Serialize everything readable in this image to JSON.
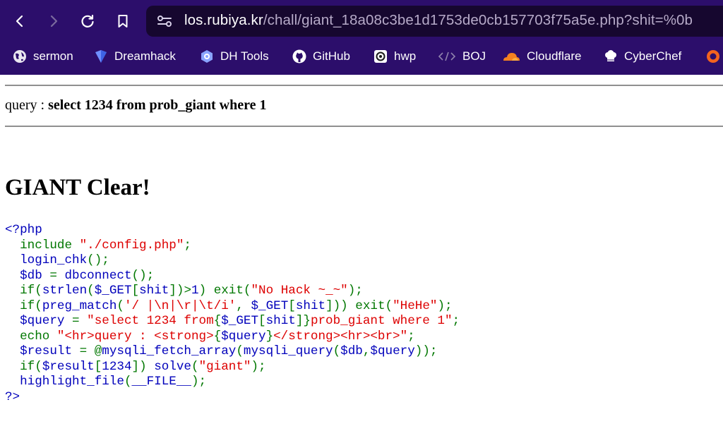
{
  "browser": {
    "url_host": "los.rubiya.kr",
    "url_rest": "/chall/giant_18a08c3be1d1753de0cb157703f75a5e.php?shit=%0b"
  },
  "bookmarks": [
    {
      "label": "sermon",
      "icon": "globe-icon"
    },
    {
      "label": "Dreamhack",
      "icon": "dreamhack-icon"
    },
    {
      "label": "DH Tools",
      "icon": "dh-tools-icon"
    },
    {
      "label": "GitHub",
      "icon": "github-icon"
    },
    {
      "label": "hwp",
      "icon": "hwp-icon"
    },
    {
      "label": "BOJ",
      "icon": "code-brackets-icon"
    },
    {
      "label": "Cloudflare",
      "icon": "cloudflare-icon"
    },
    {
      "label": "CyberChef",
      "icon": "chef-hat-icon"
    }
  ],
  "page": {
    "query_label": "query : ",
    "query_value": "select 1234 from prob_giant where 1",
    "heading": "GIANT Clear!"
  },
  "code": {
    "lines": [
      [
        {
          "t": "<?php",
          "c": "b"
        }
      ],
      [
        {
          "t": "  ",
          "c": "b"
        },
        {
          "t": "include ",
          "c": "k"
        },
        {
          "t": "\"./config.php\"",
          "c": "s"
        },
        {
          "t": ";",
          "c": "k"
        }
      ],
      [
        {
          "t": "  login_chk",
          "c": "b"
        },
        {
          "t": "();",
          "c": "k"
        }
      ],
      [
        {
          "t": "  $db ",
          "c": "b"
        },
        {
          "t": "= ",
          "c": "k"
        },
        {
          "t": "dbconnect",
          "c": "b"
        },
        {
          "t": "();",
          "c": "k"
        }
      ],
      [
        {
          "t": "  ",
          "c": "b"
        },
        {
          "t": "if(",
          "c": "k"
        },
        {
          "t": "strlen",
          "c": "b"
        },
        {
          "t": "(",
          "c": "k"
        },
        {
          "t": "$_GET",
          "c": "b"
        },
        {
          "t": "[",
          "c": "k"
        },
        {
          "t": "shit",
          "c": "b"
        },
        {
          "t": "])>",
          "c": "k"
        },
        {
          "t": "1",
          "c": "b"
        },
        {
          "t": ") exit(",
          "c": "k"
        },
        {
          "t": "\"No Hack ~_~\"",
          "c": "s"
        },
        {
          "t": ");",
          "c": "k"
        }
      ],
      [
        {
          "t": "  ",
          "c": "b"
        },
        {
          "t": "if(",
          "c": "k"
        },
        {
          "t": "preg_match",
          "c": "b"
        },
        {
          "t": "(",
          "c": "k"
        },
        {
          "t": "'/ |\\n|\\r|\\t/i'",
          "c": "s"
        },
        {
          "t": ", ",
          "c": "k"
        },
        {
          "t": "$_GET",
          "c": "b"
        },
        {
          "t": "[",
          "c": "k"
        },
        {
          "t": "shit",
          "c": "b"
        },
        {
          "t": "])) exit(",
          "c": "k"
        },
        {
          "t": "\"HeHe\"",
          "c": "s"
        },
        {
          "t": ");",
          "c": "k"
        }
      ],
      [
        {
          "t": "  $query ",
          "c": "b"
        },
        {
          "t": "= ",
          "c": "k"
        },
        {
          "t": "\"select 1234 from",
          "c": "s"
        },
        {
          "t": "{",
          "c": "k"
        },
        {
          "t": "$_GET",
          "c": "b"
        },
        {
          "t": "[",
          "c": "k"
        },
        {
          "t": "shit",
          "c": "b"
        },
        {
          "t": "]}",
          "c": "k"
        },
        {
          "t": "prob_giant where 1\"",
          "c": "s"
        },
        {
          "t": ";",
          "c": "k"
        }
      ],
      [
        {
          "t": "  ",
          "c": "b"
        },
        {
          "t": "echo ",
          "c": "k"
        },
        {
          "t": "\"<hr>query : <strong>",
          "c": "s"
        },
        {
          "t": "{",
          "c": "k"
        },
        {
          "t": "$query",
          "c": "b"
        },
        {
          "t": "}",
          "c": "k"
        },
        {
          "t": "</strong><hr><br>\"",
          "c": "s"
        },
        {
          "t": ";",
          "c": "k"
        }
      ],
      [
        {
          "t": "  $result ",
          "c": "b"
        },
        {
          "t": "= @",
          "c": "k"
        },
        {
          "t": "mysqli_fetch_array",
          "c": "b"
        },
        {
          "t": "(",
          "c": "k"
        },
        {
          "t": "mysqli_query",
          "c": "b"
        },
        {
          "t": "(",
          "c": "k"
        },
        {
          "t": "$db",
          "c": "b"
        },
        {
          "t": ",",
          "c": "k"
        },
        {
          "t": "$query",
          "c": "b"
        },
        {
          "t": "));",
          "c": "k"
        }
      ],
      [
        {
          "t": "  ",
          "c": "b"
        },
        {
          "t": "if(",
          "c": "k"
        },
        {
          "t": "$result",
          "c": "b"
        },
        {
          "t": "[",
          "c": "k"
        },
        {
          "t": "1234",
          "c": "b"
        },
        {
          "t": "]) ",
          "c": "k"
        },
        {
          "t": "solve",
          "c": "b"
        },
        {
          "t": "(",
          "c": "k"
        },
        {
          "t": "\"giant\"",
          "c": "s"
        },
        {
          "t": ");",
          "c": "k"
        }
      ],
      [
        {
          "t": "  highlight_file",
          "c": "b"
        },
        {
          "t": "(",
          "c": "k"
        },
        {
          "t": "__FILE__",
          "c": "b"
        },
        {
          "t": ");",
          "c": "k"
        }
      ],
      [
        {
          "t": "?>",
          "c": "b"
        }
      ]
    ]
  }
}
